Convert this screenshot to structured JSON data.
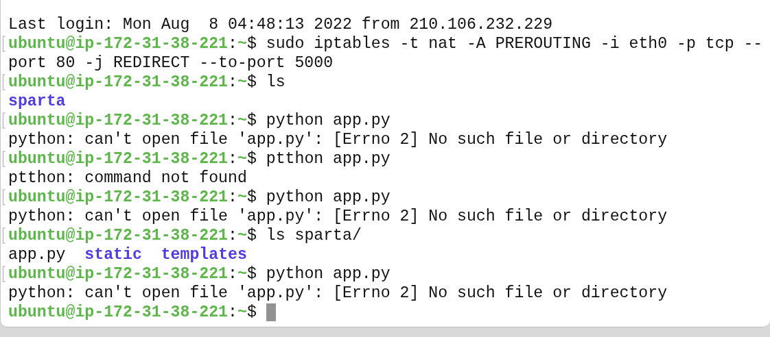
{
  "terminal": {
    "lines": [
      {
        "marked": false,
        "cursor": false,
        "segments": [
          {
            "kind": "plain",
            "text": "Last login: Mon Aug  8 04:48:13 2022 from 210.106.232.229"
          }
        ]
      },
      {
        "marked": true,
        "cursor": false,
        "segments": [
          {
            "kind": "user",
            "text": "ubuntu@ip-172-31-38-221"
          },
          {
            "kind": "plain",
            "text": ":"
          },
          {
            "kind": "path",
            "text": "~"
          },
          {
            "kind": "plain",
            "text": "$ sudo iptables -t nat -A PREROUTING -i eth0 -p tcp --"
          }
        ]
      },
      {
        "marked": false,
        "cursor": false,
        "segments": [
          {
            "kind": "plain",
            "text": "port 80 -j REDIRECT --to-port 5000"
          }
        ]
      },
      {
        "marked": true,
        "cursor": false,
        "segments": [
          {
            "kind": "user",
            "text": "ubuntu@ip-172-31-38-221"
          },
          {
            "kind": "plain",
            "text": ":"
          },
          {
            "kind": "path",
            "text": "~"
          },
          {
            "kind": "plain",
            "text": "$ ls"
          }
        ]
      },
      {
        "marked": false,
        "cursor": false,
        "segments": [
          {
            "kind": "dir",
            "text": "sparta"
          }
        ]
      },
      {
        "marked": true,
        "cursor": false,
        "segments": [
          {
            "kind": "user",
            "text": "ubuntu@ip-172-31-38-221"
          },
          {
            "kind": "plain",
            "text": ":"
          },
          {
            "kind": "path",
            "text": "~"
          },
          {
            "kind": "plain",
            "text": "$ python app.py"
          }
        ]
      },
      {
        "marked": false,
        "cursor": false,
        "segments": [
          {
            "kind": "plain",
            "text": "python: can't open file 'app.py': [Errno 2] No such file or directory"
          }
        ]
      },
      {
        "marked": true,
        "cursor": false,
        "segments": [
          {
            "kind": "user",
            "text": "ubuntu@ip-172-31-38-221"
          },
          {
            "kind": "plain",
            "text": ":"
          },
          {
            "kind": "path",
            "text": "~"
          },
          {
            "kind": "plain",
            "text": "$ ptthon app.py"
          }
        ]
      },
      {
        "marked": false,
        "cursor": false,
        "segments": [
          {
            "kind": "plain",
            "text": "ptthon: command not found"
          }
        ]
      },
      {
        "marked": true,
        "cursor": false,
        "segments": [
          {
            "kind": "user",
            "text": "ubuntu@ip-172-31-38-221"
          },
          {
            "kind": "plain",
            "text": ":"
          },
          {
            "kind": "path",
            "text": "~"
          },
          {
            "kind": "plain",
            "text": "$ python app.py"
          }
        ]
      },
      {
        "marked": false,
        "cursor": false,
        "segments": [
          {
            "kind": "plain",
            "text": "python: can't open file 'app.py': [Errno 2] No such file or directory"
          }
        ]
      },
      {
        "marked": true,
        "cursor": false,
        "segments": [
          {
            "kind": "user",
            "text": "ubuntu@ip-172-31-38-221"
          },
          {
            "kind": "plain",
            "text": ":"
          },
          {
            "kind": "path",
            "text": "~"
          },
          {
            "kind": "plain",
            "text": "$ ls sparta/"
          }
        ]
      },
      {
        "marked": false,
        "cursor": false,
        "segments": [
          {
            "kind": "plain",
            "text": "app.py"
          },
          {
            "kind": "dir",
            "text": "static"
          },
          {
            "kind": "dir",
            "text": "templates"
          }
        ]
      },
      {
        "marked": true,
        "cursor": false,
        "segments": [
          {
            "kind": "user",
            "text": "ubuntu@ip-172-31-38-221"
          },
          {
            "kind": "plain",
            "text": ":"
          },
          {
            "kind": "path",
            "text": "~"
          },
          {
            "kind": "plain",
            "text": "$ python app.py"
          }
        ]
      },
      {
        "marked": false,
        "cursor": false,
        "segments": [
          {
            "kind": "plain",
            "text": "python: can't open file 'app.py': [Errno 2] No such file or directory"
          }
        ]
      },
      {
        "marked": false,
        "cursor": true,
        "segments": [
          {
            "kind": "user",
            "text": "ubuntu@ip-172-31-38-221"
          },
          {
            "kind": "plain",
            "text": ":"
          },
          {
            "kind": "path",
            "text": "~"
          },
          {
            "kind": "plain",
            "text": "$"
          }
        ]
      }
    ]
  }
}
